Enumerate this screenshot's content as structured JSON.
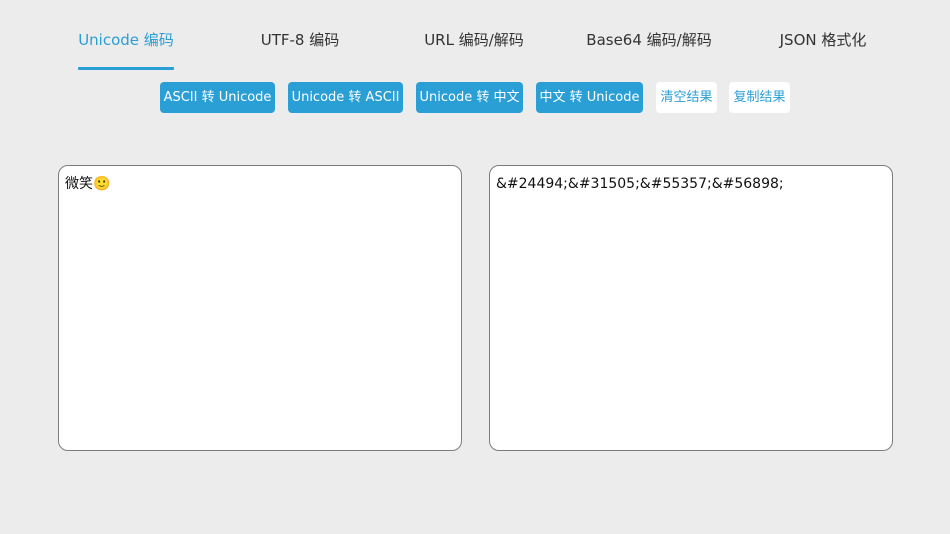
{
  "tabs": [
    {
      "label": "Unicode 编码",
      "active": true
    },
    {
      "label": "UTF-8 编码",
      "active": false
    },
    {
      "label": "URL 编码/解码",
      "active": false
    },
    {
      "label": "Base64 编码/解码",
      "active": false
    },
    {
      "label": "JSON 格式化",
      "active": false
    }
  ],
  "toolbar": {
    "ascii_to_unicode": "ASCII 转 Unicode",
    "unicode_to_ascii": "Unicode 转 ASCII",
    "unicode_to_chinese": "Unicode 转 中文",
    "chinese_to_unicode": "中文 转 Unicode",
    "clear_result": "清空结果",
    "copy_result": "复制结果"
  },
  "input": {
    "value": "微笑🙂"
  },
  "output": {
    "value": "&#24494;&#31505;&#55357;&#56898;"
  },
  "colors": {
    "accent": "#2a9fd6",
    "background": "#ececec",
    "panel_border": "#7d7d7d"
  }
}
